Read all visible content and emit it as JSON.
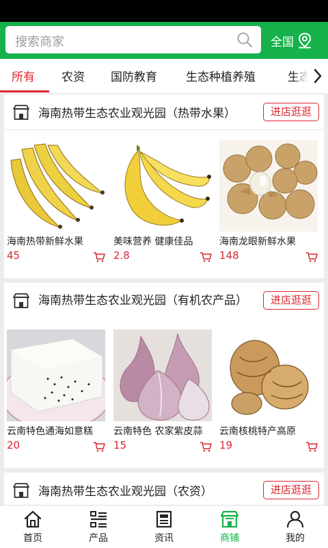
{
  "search": {
    "placeholder": "搜索商家"
  },
  "region": {
    "label": "全国"
  },
  "tabs": [
    "所有",
    "农资",
    "国防教育",
    "生态种植养殖",
    "生态"
  ],
  "stores": [
    {
      "title": "海南热带生态农业观光园（热带水果）",
      "button": "进店逛逛",
      "products": [
        {
          "name": "海南热带新鲜水果",
          "price": "45"
        },
        {
          "name": "美味营养 健康佳品",
          "price": "2.8"
        },
        {
          "name": "海南龙眼新鲜水果",
          "price": "148"
        }
      ]
    },
    {
      "title": "海南热带生态农业观光园（有机农产品）",
      "button": "进店逛逛",
      "products": [
        {
          "name": "云南特色通海如意糕",
          "price": "20"
        },
        {
          "name": "云南特色 农家紫皮蒜",
          "price": "15"
        },
        {
          "name": "云南核桃特产高原",
          "price": "19"
        }
      ]
    },
    {
      "title": "海南热带生态农业观光园（农资）",
      "button": "进店逛逛"
    }
  ],
  "nav": [
    {
      "label": "首页",
      "icon": "home-icon"
    },
    {
      "label": "产品",
      "icon": "list-icon"
    },
    {
      "label": "资讯",
      "icon": "news-icon"
    },
    {
      "label": "商铺",
      "icon": "store-icon"
    },
    {
      "label": "我的",
      "icon": "user-icon"
    }
  ],
  "colors": {
    "brand_green": "#16b14a",
    "accent_red": "#d9262f",
    "tab_active": "#e0262f"
  }
}
